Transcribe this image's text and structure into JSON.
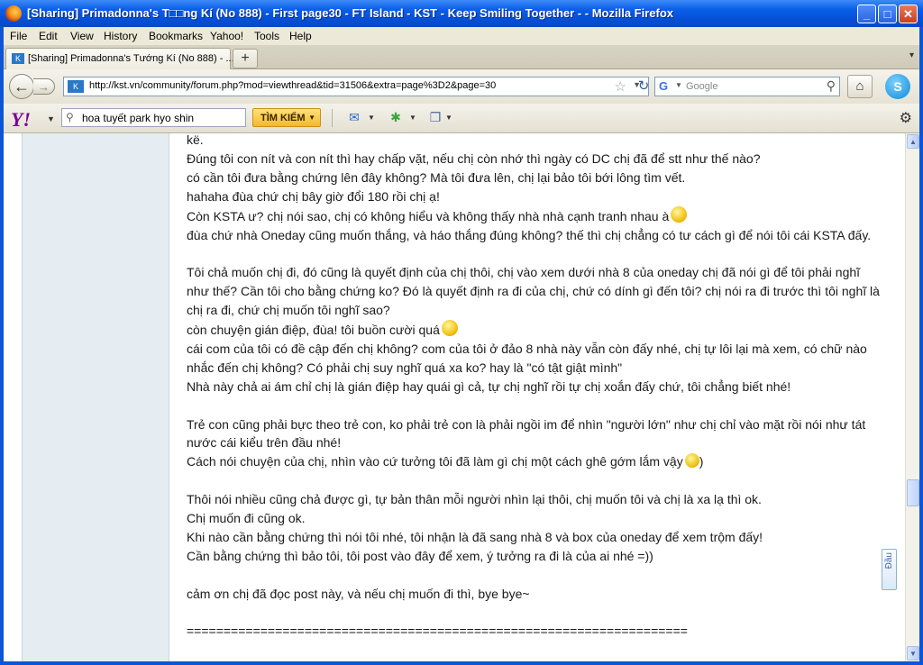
{
  "window": {
    "title": "[Sharing] Primadonna's T□□ng Kí (No 888) - First page30 - FT Island - KST - Keep Smiling Together - - Mozilla Firefox",
    "controls": [
      "_",
      "□",
      "✕"
    ]
  },
  "menu": [
    "File",
    "Edit",
    "View",
    "History",
    "Bookmarks",
    "Yahoo!",
    "Tools",
    "Help"
  ],
  "tab": {
    "label": "[Sharing] Primadonna's Tướng Kí (No 888) - ...",
    "new_tab": "+"
  },
  "nav": {
    "url": "http://kst.vn/community/forum.php?mod=viewthread&tid=31506&extra=page%3D2&page=30",
    "search_placeholder": "Google"
  },
  "yahoo": {
    "logo": "Y!",
    "search_value": "hoa tuyết park hyo shin",
    "search_button": "TÌM KIẾM"
  },
  "post": {
    "lines": [
      "kë.",
      "Đúng tôi con nít và con nít thì hay chấp vặt, nếu chị còn nhớ thì ngày có DC chị đã để stt như thế nào?",
      "có cần tôi đưa bằng chứng lên đây không? Mà tôi đưa lên, chị lại bảo tôi bới lông tìm vết.",
      "hahaha đùa chứ chị bây giờ đổi 180 rồi chị ạ!",
      "Còn KSTA ư? chị nói sao, chị có không hiểu và không thấy nhà nhà cạnh tranh nhau à",
      "đùa chứ nhà Oneday cũng muốn thắng, và háo thắng đúng không? thế thì chị chẳng có tư cách gì để nói tôi cái KSTA đấy.",
      "",
      "Tôi chả muốn chị đi, đó cũng là quyết định của chị thôi, chị vào xem dưới nhà 8 của oneday chị đã nói gì để tôi phải nghĩ",
      "như thế? Cần tôi cho bằng chứng ko? Đó là quyết định ra đi của chị, chứ có dính gì đến tôi? chị nói ra đi trước thì tôi nghĩ là",
      "chị ra đi, chứ chị muốn tôi nghĩ sao?",
      "còn chuyện gián điệp, đùa! tôi buồn cười quá",
      "cái com của tôi có đề cập đến chị không? com của tôi ở đảo 8 nhà này vẫn còn đấy nhé, chị tự lôi lại mà xem, có chữ nào",
      "nhắc đến chị không? Có phải chị suy nghĩ quá xa ko? hay là \"có tật giật mình\"",
      "Nhà này chả ai ám chỉ chị là gián điệp hay quái gì cả, tự chị nghĩ rồi tự chị xoắn đấy chứ, tôi chẳng biết nhé!",
      "",
      "Trẻ con cũng phải bực theo trẻ con, ko phải trẻ con là phải ngồi im để nhìn \"người lớn\" như chị chỉ vào mặt rồi nói như tát",
      "nước cái kiểu trên đầu nhé!",
      "Cách nói chuyện của chị, nhìn vào cứ tưởng tôi đã làm gì chị một cách ghê gớm lắm vậy",
      "",
      "Thôi nói nhiều cũng chả được gì, tự bản thân mỗi người nhìn lại thôi, chị muốn tôi và chị là xa lạ thì ok.",
      "Chị muốn đi cũng ok.",
      "Khi nào cần bằng chứng thì nói tôi nhé, tôi nhận là đã sang nhà 8 và box của oneday để xem trộm đấy!",
      "Cần bằng chứng thì bảo tôi, tôi post vào đây để xem, ý tưởng ra đi là của ai nhé =))",
      "",
      "cảm ơn chị đã đọc post này, và nếu chị muốn đi thì, bye bye~",
      "",
      "===================================================================="
    ],
    "emoticon_suffix_line18": ")"
  },
  "side_button": "Đầu"
}
